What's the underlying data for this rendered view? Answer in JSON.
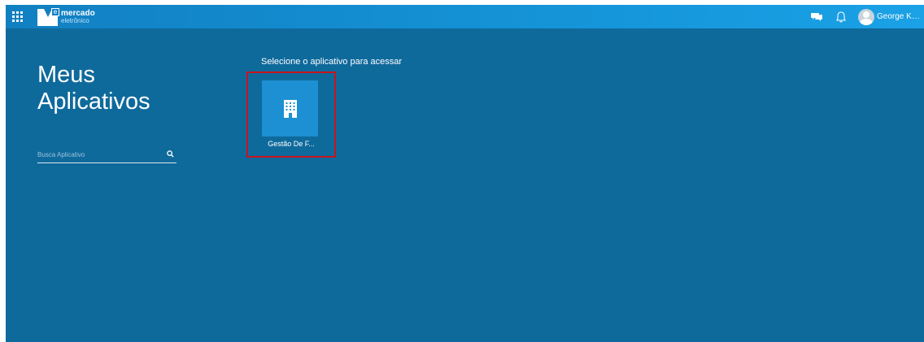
{
  "header": {
    "logo": {
      "line1": "mercado",
      "line2": "eletrônico",
      "mark_letter": "e"
    },
    "apps_menu_icon": "apps-grid-icon",
    "chat_icon": "chat-icon",
    "notifications_icon": "bell-icon",
    "user": {
      "name": "George Kanomat..."
    }
  },
  "sidebar": {
    "title_line1": "Meus",
    "title_line2": "Aplicativos",
    "search": {
      "placeholder": "Busca Aplicativo",
      "value": "",
      "icon": "search-icon"
    }
  },
  "main": {
    "prompt": "Selecione o aplicativo para acessar",
    "apps": [
      {
        "label": "Gestão De F...",
        "icon": "building-icon"
      }
    ]
  },
  "colors": {
    "background": "#0f6a9c",
    "topbar": "#1594d8",
    "app_tile": "#1c90d2",
    "highlight_border": "#c8141c"
  }
}
